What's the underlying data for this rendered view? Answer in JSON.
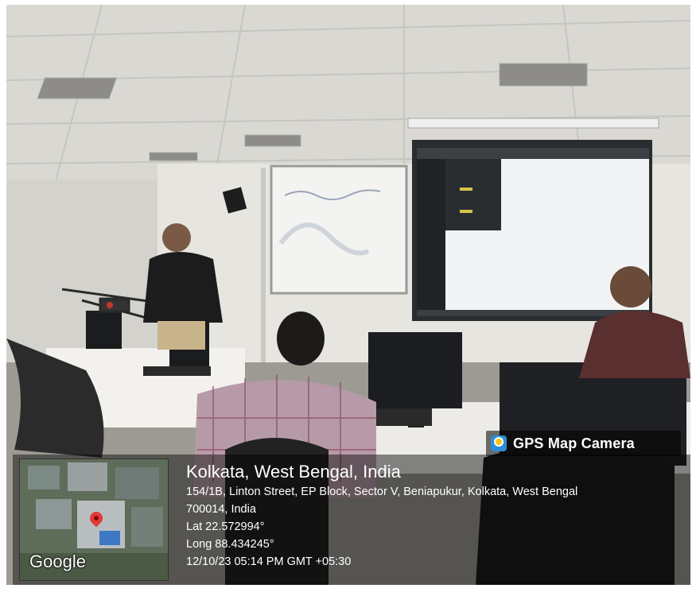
{
  "overlay": {
    "badge_label": "GPS Map Camera",
    "location_title": "Kolkata, West Bengal, India",
    "address_line1": "154/1B, Linton Street, EP Block, Sector V, Beniapukur, Kolkata, West Bengal",
    "address_line2": "700014, India",
    "latitude": "Lat 22.572994°",
    "longitude": "Long 88.434245°",
    "timestamp": "12/10/23 05:14 PM GMT +05:30",
    "map_brand": "Google"
  },
  "colors": {
    "badge_bg": "#000000",
    "pin": "#e53935",
    "screen": "#f2f3f4"
  },
  "icons": [
    "gps-camera-icon",
    "map-pin-icon"
  ]
}
